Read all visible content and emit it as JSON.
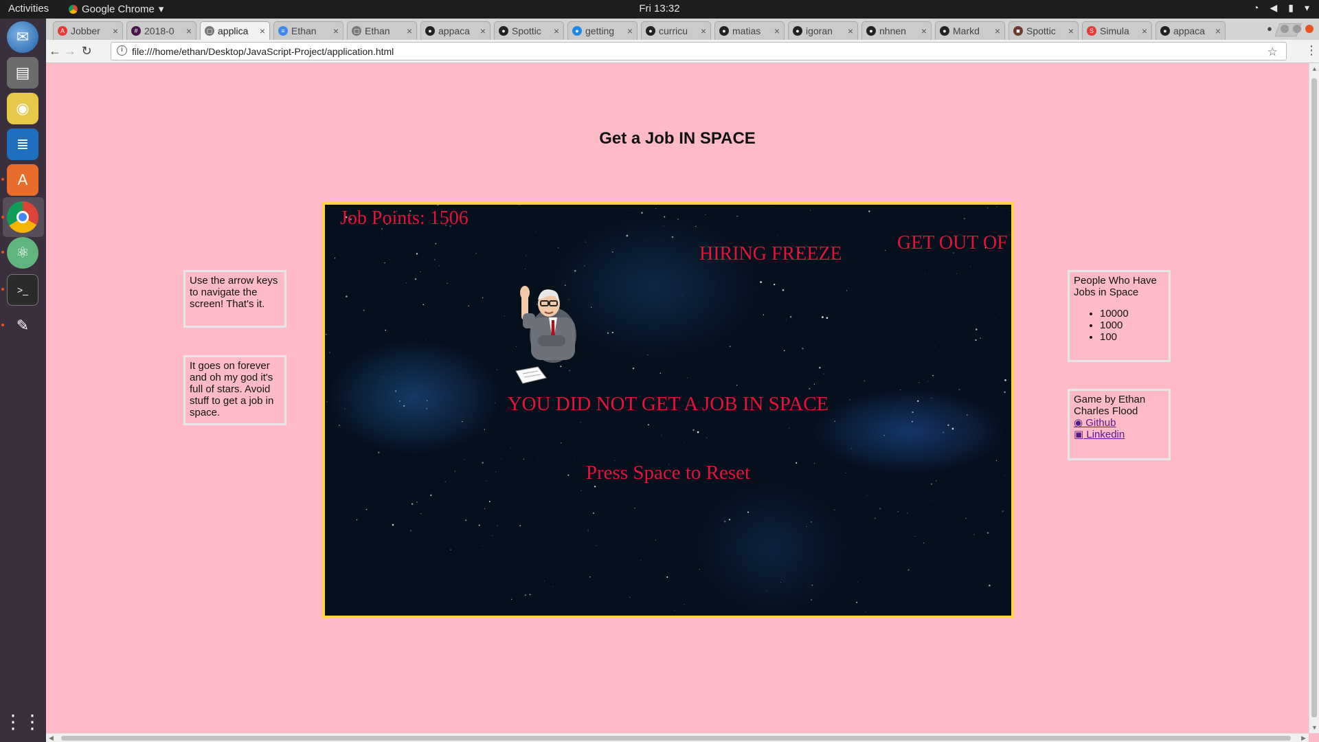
{
  "topbar": {
    "activities": "Activities",
    "app_name": "Google Chrome",
    "app_menu_arrow": "▾",
    "clock": "Fri 13:32"
  },
  "dock": {
    "items": [
      "thunderbird-icon",
      "files-icon",
      "rhythmbox-icon",
      "writer-icon",
      "software-center-icon",
      "chrome-icon",
      "atom-icon",
      "terminal-icon",
      "gimp-icon",
      "app-grid-icon"
    ]
  },
  "browser": {
    "tabs": [
      {
        "label": "Jobber",
        "icon": "A",
        "color": "#e53935"
      },
      {
        "label": "2018-0",
        "icon": "#",
        "color": "#4a154b"
      },
      {
        "label": "applica",
        "icon": "▢",
        "color": "#777777",
        "active": true
      },
      {
        "label": "Ethan",
        "icon": "≡",
        "color": "#4285f4"
      },
      {
        "label": "Ethan",
        "icon": "▢",
        "color": "#777777"
      },
      {
        "label": "appaca",
        "icon": "●",
        "color": "#222222"
      },
      {
        "label": "Spottic",
        "icon": "●",
        "color": "#222222"
      },
      {
        "label": "getting",
        "icon": "●",
        "color": "#1e88e5"
      },
      {
        "label": "curricu",
        "icon": "●",
        "color": "#222222"
      },
      {
        "label": "matias",
        "icon": "●",
        "color": "#222222"
      },
      {
        "label": "igoran",
        "icon": "●",
        "color": "#222222"
      },
      {
        "label": "nhnen",
        "icon": "●",
        "color": "#222222"
      },
      {
        "label": "Markd",
        "icon": "●",
        "color": "#222222"
      },
      {
        "label": "Spottic",
        "icon": "■",
        "color": "#6d3b2e"
      },
      {
        "label": "Simula",
        "icon": "S",
        "color": "#e53935"
      },
      {
        "label": "appaca",
        "icon": "●",
        "color": "#222222"
      }
    ],
    "close_glyph": "×",
    "url": "file:///home/ethan/Desktop/JavaScript-Project/application.html"
  },
  "page": {
    "title": "Get a Job IN SPACE",
    "instructions_1": "Use the arrow keys to navigate the screen! That's it.",
    "instructions_2": "It goes on forever and oh my god it's full of stars. Avoid stuff to get a job in space.",
    "leaderboard": {
      "heading": "People Who Have Jobs in Space",
      "scores": [
        "10000",
        "1000",
        "100"
      ]
    },
    "credits": {
      "text": "Game by Ethan Charles Flood",
      "github": " Github",
      "linkedin": " Linkedin"
    }
  },
  "game": {
    "score_label": "Job Points: 1506",
    "enemy_1": "HIRING FREEZE",
    "enemy_2": "GET OUT OF",
    "game_over": "YOU DID NOT GET A JOB IN SPACE",
    "reset_prompt": "Press Space to Reset",
    "text_color": "#e4133a",
    "border_color": "#ffd23e"
  }
}
